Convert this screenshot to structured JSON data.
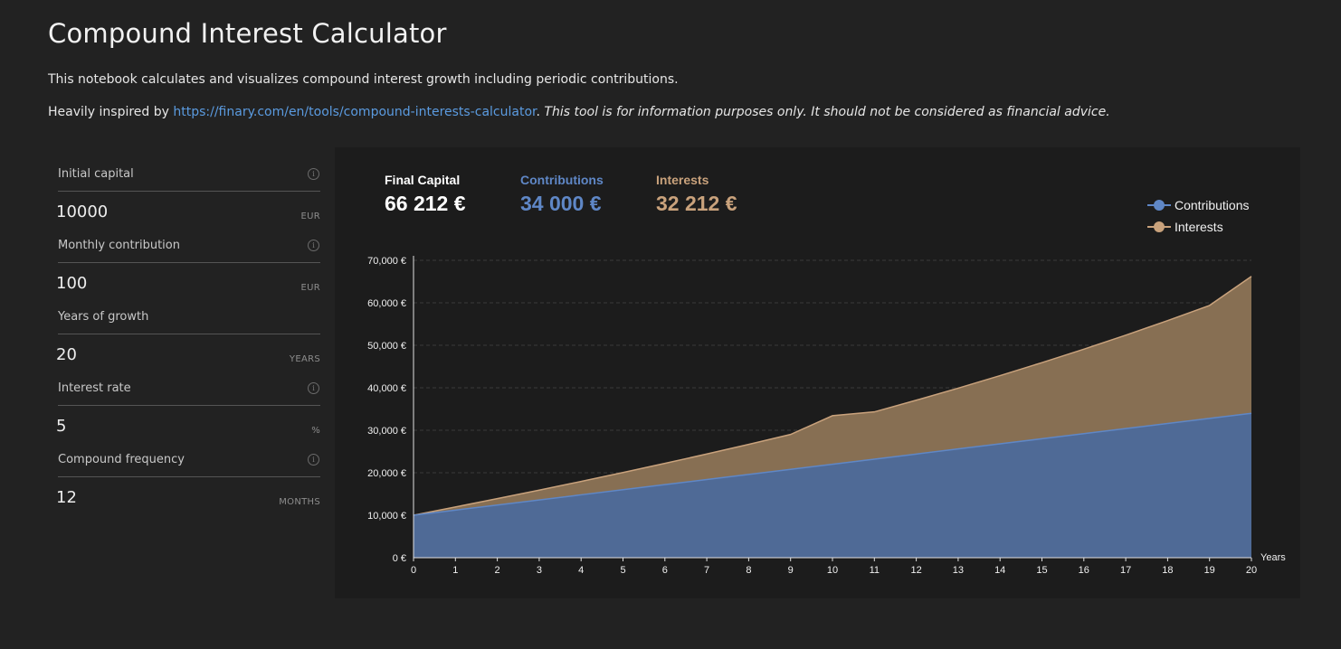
{
  "page": {
    "title": "Compound Interest Calculator",
    "intro": "This notebook calculates and visualizes compound interest growth including periodic contributions.",
    "inspired_prefix": "Heavily inspired by ",
    "inspired_link": "https://finary.com/en/tools/compound-interests-calculator",
    "inspired_dot": ".",
    "disclaimer": " This tool is for information purposes only. It should not be considered as financial advice."
  },
  "form": {
    "fields": [
      {
        "label": "Initial capital",
        "value": "10000",
        "unit": "EUR",
        "info": true
      },
      {
        "label": "Monthly contribution",
        "value": "100",
        "unit": "EUR",
        "info": true
      },
      {
        "label": "Years of growth",
        "value": "20",
        "unit": "YEARS",
        "info": false
      },
      {
        "label": "Interest rate",
        "value": "5",
        "unit": "%",
        "info": true
      },
      {
        "label": "Compound frequency",
        "value": "12",
        "unit": "MONTHS",
        "info": true
      }
    ],
    "info_glyph": "i"
  },
  "summary": {
    "final_capital_label": "Final Capital",
    "final_capital_value": "66 212 €",
    "contributions_label": "Contributions",
    "contributions_value": "34 000 €",
    "interests_label": "Interests",
    "interests_value": "32 212 €"
  },
  "legend": {
    "contributions": "Contributions",
    "interests": "Interests"
  },
  "colors": {
    "contributions": "#5f87c6",
    "contributions_fill": "#4f6a96",
    "interests": "#c9a27c",
    "interests_fill": "#876f53",
    "final_capital": "#ffffff"
  },
  "chart_data": {
    "type": "area",
    "stacked": true,
    "xlabel": "Years",
    "ylabel": "",
    "x": [
      0,
      1,
      2,
      3,
      4,
      5,
      6,
      7,
      8,
      9,
      10,
      11,
      12,
      13,
      14,
      15,
      16,
      17,
      18,
      19,
      20
    ],
    "ylim": [
      0,
      70000
    ],
    "yticks": [
      0,
      10000,
      20000,
      30000,
      40000,
      50000,
      60000,
      70000
    ],
    "ytick_labels": [
      "0 €",
      "10,000 €",
      "20,000 €",
      "30,000 €",
      "40,000 €",
      "50,000 €",
      "60,000 €",
      "70,000 €"
    ],
    "grid": true,
    "legend_position": "top-right",
    "series": [
      {
        "name": "Contributions",
        "values": [
          10000,
          11200,
          12400,
          13600,
          14800,
          16000,
          17200,
          18400,
          19600,
          20800,
          22000,
          23200,
          24400,
          25600,
          26800,
          28000,
          29200,
          30400,
          31600,
          32800,
          34000
        ]
      },
      {
        "name": "Interests",
        "values": [
          0,
          739,
          1505,
          2306,
          3160,
          4053,
          5001,
          6008,
          7076,
          8210,
          11425,
          11125,
          12670,
          14312,
          16058,
          17915,
          19888,
          21985,
          24213,
          26580,
          32212
        ]
      }
    ]
  }
}
